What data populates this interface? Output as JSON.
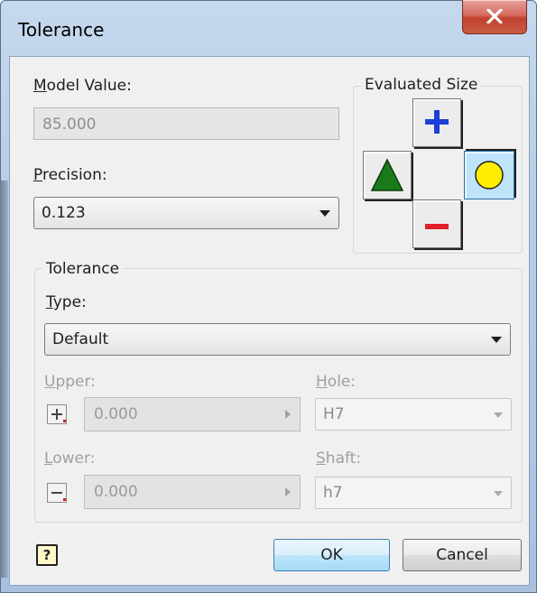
{
  "window": {
    "title": "Tolerance",
    "close_glyph": "X"
  },
  "model_value": {
    "label_u": "M",
    "label_rest": "odel Value:",
    "value": "85.000"
  },
  "precision": {
    "label_u": "P",
    "label_rest": "recision:",
    "value": "0.123"
  },
  "evaluated_size": {
    "label": "Evaluated Size",
    "buttons": {
      "upper": "plus-icon",
      "lower": "minus-icon",
      "min": "triangle-icon",
      "mean": "circle-icon"
    },
    "selected": "mean",
    "colors": {
      "plus": "#1c3fd6",
      "minus": "#e0202a",
      "triangle": "#1a7a1a",
      "circle": "#ffee00"
    }
  },
  "tolerance_group": {
    "label": "Tolerance",
    "type_label_u": "T",
    "type_label_rest": "ype:",
    "type_value": "Default",
    "upper": {
      "label_u": "U",
      "label_rest": "pper:",
      "value": "0.000"
    },
    "lower": {
      "label_u": "L",
      "label_rest": "ower:",
      "value": "0.000"
    },
    "hole": {
      "label_u": "H",
      "label_rest": "ole:",
      "value": "H7"
    },
    "shaft": {
      "label_u": "S",
      "label_rest": "haft:",
      "value": "h7"
    }
  },
  "footer": {
    "help": "?",
    "ok": "OK",
    "cancel": "Cancel"
  }
}
